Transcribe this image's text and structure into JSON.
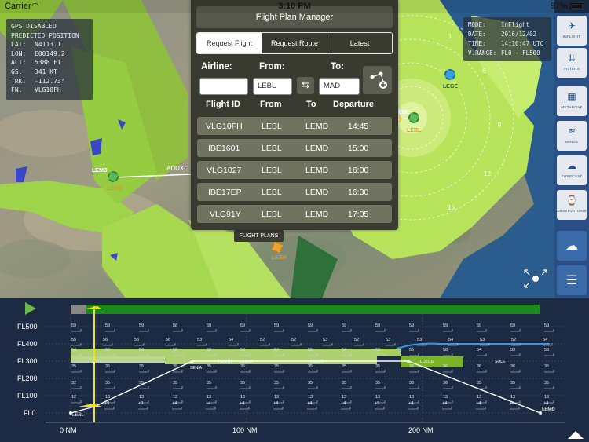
{
  "status_bar": {
    "carrier": "Carrier",
    "wifi_icon": "wifi-icon",
    "time": "3:10 PM",
    "battery": "97%"
  },
  "gps_box": {
    "title1": "GPS DISABLED",
    "title2": "PREDICTED POSITION",
    "rows": [
      {
        "k": "LAT:",
        "v": "N4113.1"
      },
      {
        "k": "LON:",
        "v": "E00149.2"
      },
      {
        "k": "ALT:",
        "v": "5388 FT"
      },
      {
        "k": "GS:",
        "v": "341 KT"
      },
      {
        "k": "TRK:",
        "v": "-112.73°"
      },
      {
        "k": "FN:",
        "v": "VLG10FH"
      }
    ]
  },
  "mode_box": {
    "rows": [
      {
        "k": "MODE:",
        "v": "InFlight"
      },
      {
        "k": "DATE:",
        "v": "2016/12/02"
      },
      {
        "k": "TIME:",
        "v": "14:10:47 UTC"
      },
      {
        "k": "V.RANGE:",
        "v": "FL0 - FL500"
      }
    ]
  },
  "map": {
    "waypoint": "ADUXO",
    "airport_lemd": "LEMD",
    "airport_lemd_sub": "LEMD",
    "airport_lebl": "LEBL",
    "airport_lebl_top": "LEBL",
    "airport_lege": "LEGE",
    "airport_lerr": "LERR",
    "range_labels": [
      "3",
      "6",
      "9",
      "12",
      "15"
    ],
    "flight_plans_button": "FLIGHT PLANS"
  },
  "fpm": {
    "title": "Flight Plan Manager",
    "tabs": [
      "Request Flight",
      "Request Route",
      "Latest"
    ],
    "airline_label": "Airline:",
    "from_label": "From:",
    "to_label": "To:",
    "airline_value": "",
    "from_value": "LEBL",
    "to_value": "MAD",
    "columns": [
      "Flight ID",
      "From",
      "To",
      "Departure"
    ],
    "rows": [
      {
        "id": "VLG10FH",
        "from": "LEBL",
        "to": "LEMD",
        "dep": "14:45"
      },
      {
        "id": "IBE1601",
        "from": "LEBL",
        "to": "LEMD",
        "dep": "15:00"
      },
      {
        "id": "VLG1027",
        "from": "LEBL",
        "to": "LEMD",
        "dep": "16:00"
      },
      {
        "id": "IBE17EP",
        "from": "LEBL",
        "to": "LEMD",
        "dep": "16:30"
      },
      {
        "id": "VLG91Y",
        "from": "LEBL",
        "to": "LEMD",
        "dep": "17:05"
      }
    ]
  },
  "sidebar": [
    {
      "label": "INFLIGHT",
      "icon": "plane-icon"
    },
    {
      "label": "FILTERS",
      "icon": "filters-icon"
    },
    {
      "label": "METAR/TAF",
      "icon": "metar-icon"
    },
    {
      "label": "WINDS",
      "icon": "winds-icon"
    },
    {
      "label": "FORECAST",
      "icon": "forecast-icon"
    },
    {
      "label": "OBSERVATIONS",
      "icon": "observations-icon"
    },
    {
      "label": "",
      "icon": "cloud-wifi-icon"
    },
    {
      "label": "",
      "icon": "menu-icon"
    }
  ],
  "profile": {
    "fl_labels": [
      "FL500",
      "FL400",
      "FL300",
      "FL200",
      "FL100",
      "FL0"
    ],
    "nm_labels": [
      "0 NM",
      "100 NM",
      "200 NM"
    ],
    "origin": "LEBL",
    "dest": "LEMD",
    "wind_row_fl400": [
      "59",
      "59",
      "59",
      "58",
      "59",
      "59",
      "59",
      "59",
      "59",
      "59",
      "59",
      "59",
      "59",
      "59",
      "59"
    ],
    "wind_row_fl360": [
      "55",
      "56",
      "56",
      "56",
      "53",
      "54",
      "52",
      "52",
      "53",
      "52",
      "53",
      "53",
      "54",
      "53",
      "52",
      "54"
    ],
    "wind_row_fl300": [
      "54",
      "56",
      "56",
      "56",
      "58",
      "54",
      "54",
      "55",
      "54",
      "53",
      "55",
      "58",
      "54",
      "53",
      "53"
    ],
    "wind_row_fl270": [
      "35",
      "35",
      "35",
      "35",
      "35",
      "35",
      "35",
      "35",
      "35",
      "35",
      "36",
      "36",
      "36",
      "36",
      "35"
    ],
    "wind_row_fl180": [
      "32",
      "35",
      "35",
      "35",
      "35",
      "35",
      "35",
      "35",
      "35",
      "35",
      "36",
      "36",
      "35",
      "35",
      "35"
    ],
    "wind_row_fl120": [
      "12",
      "13",
      "13",
      "13",
      "13",
      "13",
      "13",
      "13",
      "13",
      "13",
      "13",
      "13",
      "13",
      "13",
      "13"
    ],
    "wind_row_fl50": [
      "+9",
      "+9",
      "+4",
      "+4",
      "+4",
      "+4",
      "+4",
      "+4",
      "+5",
      "+4",
      "+4",
      "+4",
      "+4",
      "+4"
    ],
    "waypoints": [
      "SENIA",
      "MONTIT",
      "LOBAR",
      "TOSCA",
      "LOTOS",
      "SOLE"
    ]
  }
}
